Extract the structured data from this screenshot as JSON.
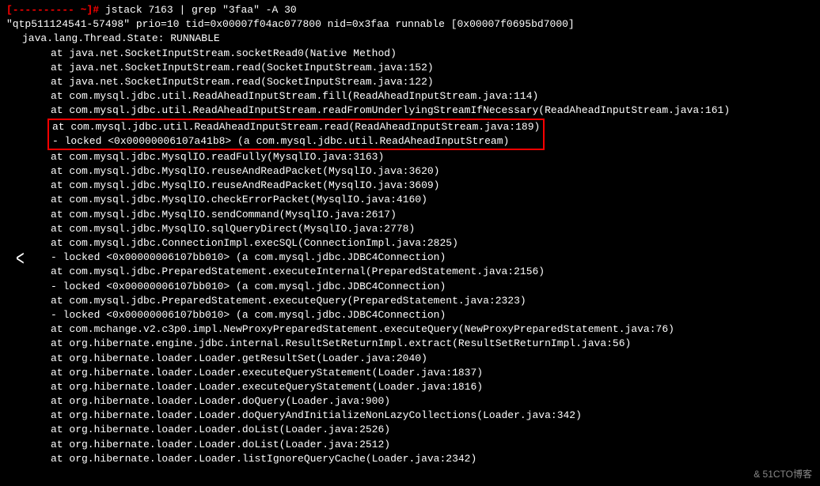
{
  "prompt": {
    "redacted_host": "[---------- ~]#",
    "command": "jstack 7163 | grep \"3faa\" -A 30"
  },
  "thread_header": "\"qtp511124541-57498\" prio=10 tid=0x00007f04ac077800 nid=0x3faa runnable [0x00007f0695bd7000]",
  "thread_state": "java.lang.Thread.State: RUNNABLE",
  "stack_pre": [
    "at java.net.SocketInputStream.socketRead0(Native Method)",
    "at java.net.SocketInputStream.read(SocketInputStream.java:152)",
    "at java.net.SocketInputStream.read(SocketInputStream.java:122)",
    "at com.mysql.jdbc.util.ReadAheadInputStream.fill(ReadAheadInputStream.java:114)",
    "at com.mysql.jdbc.util.ReadAheadInputStream.readFromUnderlyingStreamIfNecessary(ReadAheadInputStream.java:161)"
  ],
  "highlighted": [
    "at com.mysql.jdbc.util.ReadAheadInputStream.read(ReadAheadInputStream.java:189)",
    "- locked <0x00000006107a41b8> (a com.mysql.jdbc.util.ReadAheadInputStream)"
  ],
  "stack_post": [
    "at com.mysql.jdbc.MysqlIO.readFully(MysqlIO.java:3163)",
    "at com.mysql.jdbc.MysqlIO.reuseAndReadPacket(MysqlIO.java:3620)",
    "at com.mysql.jdbc.MysqlIO.reuseAndReadPacket(MysqlIO.java:3609)",
    "at com.mysql.jdbc.MysqlIO.checkErrorPacket(MysqlIO.java:4160)",
    "at com.mysql.jdbc.MysqlIO.sendCommand(MysqlIO.java:2617)",
    "at com.mysql.jdbc.MysqlIO.sqlQueryDirect(MysqlIO.java:2778)",
    "at com.mysql.jdbc.ConnectionImpl.execSQL(ConnectionImpl.java:2825)",
    "- locked <0x00000006107bb010> (a com.mysql.jdbc.JDBC4Connection)",
    "at com.mysql.jdbc.PreparedStatement.executeInternal(PreparedStatement.java:2156)",
    "- locked <0x00000006107bb010> (a com.mysql.jdbc.JDBC4Connection)",
    "at com.mysql.jdbc.PreparedStatement.executeQuery(PreparedStatement.java:2323)",
    "- locked <0x00000006107bb010> (a com.mysql.jdbc.JDBC4Connection)",
    "at com.mchange.v2.c3p0.impl.NewProxyPreparedStatement.executeQuery(NewProxyPreparedStatement.java:76)",
    "at org.hibernate.engine.jdbc.internal.ResultSetReturnImpl.extract(ResultSetReturnImpl.java:56)",
    "at org.hibernate.loader.Loader.getResultSet(Loader.java:2040)",
    "at org.hibernate.loader.Loader.executeQueryStatement(Loader.java:1837)",
    "at org.hibernate.loader.Loader.executeQueryStatement(Loader.java:1816)",
    "at org.hibernate.loader.Loader.doQuery(Loader.java:900)",
    "at org.hibernate.loader.Loader.doQueryAndInitializeNonLazyCollections(Loader.java:342)",
    "at org.hibernate.loader.Loader.doList(Loader.java:2526)",
    "at org.hibernate.loader.Loader.doList(Loader.java:2512)",
    "at org.hibernate.loader.Loader.listIgnoreQueryCache(Loader.java:2342)"
  ],
  "watermark": "& 51CTO博客",
  "caret": "<"
}
